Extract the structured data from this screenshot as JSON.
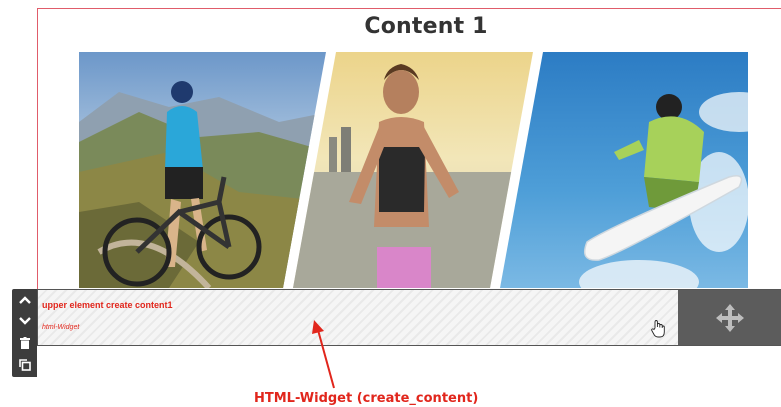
{
  "content": {
    "title": "Content 1"
  },
  "gallery": {
    "images": [
      "mountain-biker-icon",
      "runner-icon",
      "snowboarder-icon"
    ]
  },
  "widget": {
    "text": "upper element create content1",
    "subtext": "html-Widget"
  },
  "toolbar": {
    "buttons": [
      "move-up-icon",
      "move-down-icon",
      "delete-icon",
      "duplicate-icon"
    ]
  },
  "annotation": {
    "label": "HTML-Widget (create_content)"
  },
  "colors": {
    "frame_border": "#e05c6a",
    "annotation_red": "#e1261c",
    "toolbar_bg": "#3d3d3d",
    "handle_bg": "#5c5c5c"
  }
}
